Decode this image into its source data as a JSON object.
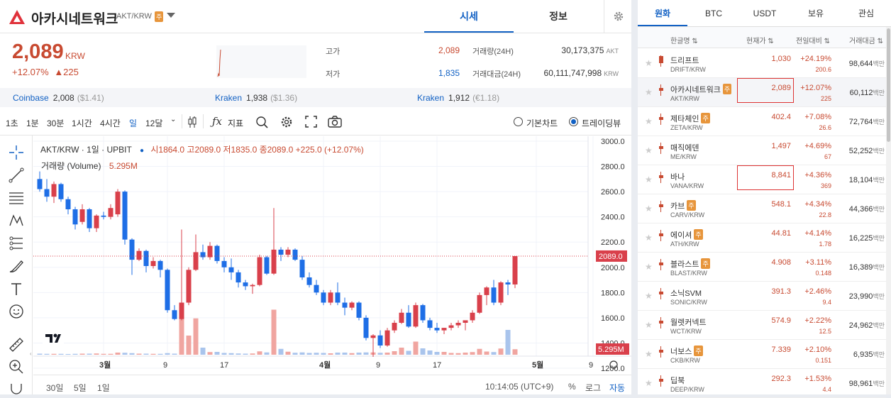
{
  "header": {
    "coin_name": "아카시네트워크",
    "pair": "AKT/KRW",
    "caution": "주",
    "tabs": [
      "시세",
      "정보"
    ]
  },
  "price": {
    "current": "2,089",
    "unit": "KRW",
    "change_pct": "+12.07%",
    "change_abs": "▲225",
    "high_label": "고가",
    "high": "2,089",
    "low_label": "저가",
    "low": "1,835",
    "vol_label": "거래량(24H)",
    "vol": "30,173,375",
    "vol_unit": "AKT",
    "amt_label": "거래대금(24H)",
    "amt": "60,111,747,998",
    "amt_unit": "KRW"
  },
  "exchanges": [
    {
      "name": "Coinbase",
      "price": "2,008",
      "sub": "($1.41)"
    },
    {
      "name": "Kraken",
      "price": "1,938",
      "sub": "($1.36)"
    },
    {
      "name": "Kraken",
      "price": "1,912",
      "sub": "(€1.18)"
    }
  ],
  "toolbar": {
    "intervals": [
      "1초",
      "1분",
      "30분",
      "1시간",
      "4시간",
      "일",
      "12달"
    ],
    "active_interval": "일",
    "indicator_label": "지표",
    "basic_chart": "기본차트",
    "trading_view": "트레이딩뷰"
  },
  "chart_legend": {
    "title": "AKT/KRW · 1일 · UPBIT",
    "ohlc": "시1864.0 고2089.0 저1835.0 종2089.0 +225.0 (+12.07%)",
    "volume_label": "거래량 (Volume)",
    "volume_value": "5.295M"
  },
  "chart_data": {
    "type": "candlestick",
    "y_ticks": [
      "3000.0",
      "2800.0",
      "2600.0",
      "2400.0",
      "2200.0",
      "2000.0",
      "1800.0",
      "1600.0",
      "1400.0",
      "1200.0"
    ],
    "x_ticks": [
      "3월",
      "9",
      "17",
      "4월",
      "9",
      "17",
      "5월",
      "9"
    ],
    "ylim": [
      1200,
      3000
    ],
    "last_price_label": "2089.0",
    "last_volume_label": "5.295M",
    "candles": [
      [
        2700,
        2760,
        2600,
        2620
      ],
      [
        2620,
        2700,
        2520,
        2560
      ],
      [
        2560,
        2680,
        2510,
        2660
      ],
      [
        2660,
        2670,
        2520,
        2540
      ],
      [
        2540,
        2560,
        2420,
        2460
      ],
      [
        2460,
        2480,
        2300,
        2340
      ],
      [
        2360,
        2500,
        2340,
        2460
      ],
      [
        2460,
        2470,
        2280,
        2310
      ],
      [
        2310,
        2420,
        2280,
        2410
      ],
      [
        2410,
        2440,
        2380,
        2400
      ],
      [
        2400,
        2500,
        2380,
        2470
      ],
      [
        2420,
        2620,
        2400,
        2600
      ],
      [
        2600,
        2610,
        2180,
        2220
      ],
      [
        2220,
        2230,
        1940,
        2060
      ],
      [
        2060,
        2150,
        2050,
        2130
      ],
      [
        2130,
        2140,
        1960,
        2010
      ],
      [
        2010,
        2080,
        1990,
        2050
      ],
      [
        2050,
        2060,
        1920,
        1980
      ],
      [
        1980,
        1990,
        1640,
        1660
      ],
      [
        1660,
        1700,
        1580,
        1590
      ],
      [
        1590,
        2300,
        1580,
        1720
      ],
      [
        1720,
        2000,
        1700,
        1980
      ],
      [
        1980,
        2260,
        1970,
        2120
      ],
      [
        2120,
        2180,
        2060,
        2080
      ],
      [
        2080,
        2200,
        2060,
        2170
      ],
      [
        2170,
        2180,
        2030,
        2050
      ],
      [
        2050,
        2080,
        1960,
        2000
      ],
      [
        2000,
        2070,
        1900,
        1960
      ],
      [
        1960,
        1980,
        1840,
        1880
      ],
      [
        1880,
        1900,
        1820,
        1850
      ],
      [
        1850,
        1870,
        1790,
        1860
      ],
      [
        1860,
        2100,
        1850,
        2080
      ],
      [
        2080,
        2090,
        1940,
        1950
      ],
      [
        1950,
        2470,
        1940,
        2140
      ],
      [
        2140,
        2160,
        2050,
        2100
      ],
      [
        2100,
        2160,
        2080,
        2140
      ],
      [
        2140,
        2150,
        2050,
        2060
      ],
      [
        2060,
        2090,
        1900,
        1920
      ],
      [
        1920,
        1960,
        1840,
        1860
      ],
      [
        1860,
        1900,
        1780,
        1800
      ],
      [
        1800,
        1820,
        1700,
        1720
      ],
      [
        1720,
        1820,
        1700,
        1800
      ],
      [
        1800,
        1880,
        1700,
        1720
      ],
      [
        1720,
        1760,
        1620,
        1680
      ],
      [
        1680,
        1730,
        1660,
        1720
      ],
      [
        1720,
        1730,
        1580,
        1600
      ],
      [
        1600,
        1620,
        1420,
        1440
      ],
      [
        1440,
        1470,
        1290,
        1460
      ],
      [
        1460,
        1500,
        1360,
        1380
      ],
      [
        1380,
        1520,
        1370,
        1500
      ],
      [
        1500,
        1580,
        1480,
        1560
      ],
      [
        1560,
        1670,
        1550,
        1640
      ],
      [
        1640,
        1700,
        1520,
        1530
      ],
      [
        1530,
        1720,
        1520,
        1700
      ],
      [
        1700,
        1710,
        1560,
        1580
      ],
      [
        1580,
        1600,
        1500,
        1520
      ],
      [
        1520,
        1560,
        1480,
        1500
      ],
      [
        1500,
        1520,
        1470,
        1520
      ],
      [
        1520,
        1560,
        1500,
        1540
      ],
      [
        1540,
        1580,
        1520,
        1560
      ],
      [
        1560,
        1580,
        1500,
        1580
      ],
      [
        1580,
        1660,
        1560,
        1640
      ],
      [
        1640,
        1800,
        1630,
        1780
      ],
      [
        1780,
        1850,
        1700,
        1840
      ],
      [
        1840,
        1900,
        1700,
        1720
      ],
      [
        1720,
        1890,
        1700,
        1880
      ],
      [
        1880,
        1900,
        1780,
        1864
      ],
      [
        1864,
        2089,
        1835,
        2089
      ]
    ],
    "volume_up": [
      false,
      false,
      true,
      false,
      false,
      false,
      true,
      false,
      true,
      true,
      true,
      true,
      false,
      false,
      true,
      false,
      true,
      false,
      false,
      false,
      true,
      true,
      true,
      false,
      true,
      false,
      false,
      false,
      false,
      false,
      true,
      true,
      false,
      true,
      false,
      true,
      false,
      false,
      false,
      false,
      false,
      true,
      false,
      false,
      true,
      false,
      false,
      true,
      false,
      true,
      true,
      true,
      false,
      true,
      false,
      false,
      false,
      true,
      true,
      true,
      true,
      true,
      true,
      true,
      false,
      true,
      false,
      true
    ],
    "volumes": [
      0.6,
      0.5,
      0.5,
      0.5,
      0.4,
      0.5,
      0.6,
      0.6,
      0.7,
      0.5,
      0.5,
      1.2,
      1.1,
      0.9,
      0.6,
      0.6,
      0.5,
      0.5,
      0.9,
      0.6,
      24.5,
      10.8,
      20.5,
      4.0,
      1.5,
      1.6,
      1.0,
      0.9,
      0.7,
      0.6,
      0.7,
      1.9,
      1.3,
      25.4,
      3.3,
      1.7,
      1.1,
      1.3,
      1.0,
      1.1,
      1.0,
      0.8,
      1.2,
      1.2,
      0.9,
      1.2,
      1.3,
      1.3,
      1.1,
      1.2,
      2.0,
      4.0,
      2.2,
      7.4,
      3.6,
      2.4,
      1.6,
      1.6,
      1.0,
      0.9,
      1.2,
      1.5,
      3.3,
      1.8,
      1.5,
      3.5,
      14.0,
      3.1
    ]
  },
  "bottom_bar": {
    "ranges": [
      "30일",
      "5일",
      "1일"
    ],
    "clock": "10:14:05 (UTC+9)",
    "pct": "%",
    "log": "로그",
    "auto": "자동"
  },
  "market": {
    "tabs": [
      "원화",
      "BTC",
      "USDT",
      "보유",
      "관심"
    ],
    "headers": [
      "한글명",
      "현재가",
      "전일대비",
      "거래대금"
    ],
    "rows": [
      {
        "name": "드리프트",
        "symbol": "DRIFT/KRW",
        "price": "1,030",
        "pct": "+24.19%",
        "abs": "200.6",
        "vol": "98,644",
        "caution": false
      },
      {
        "name": "아카시네트워크",
        "symbol": "AKT/KRW",
        "price": "2,089",
        "pct": "+12.07%",
        "abs": "225",
        "vol": "60,112",
        "caution": true
      },
      {
        "name": "제타체인",
        "symbol": "ZETA/KRW",
        "price": "402.4",
        "pct": "+7.08%",
        "abs": "26.6",
        "vol": "72,764",
        "caution": true
      },
      {
        "name": "매직에덴",
        "symbol": "ME/KRW",
        "price": "1,497",
        "pct": "+4.69%",
        "abs": "67",
        "vol": "52,252",
        "caution": false
      },
      {
        "name": "바나",
        "symbol": "VANA/KRW",
        "price": "8,841",
        "pct": "+4.36%",
        "abs": "369",
        "vol": "18,104",
        "caution": false
      },
      {
        "name": "카브",
        "symbol": "CARV/KRW",
        "price": "548.1",
        "pct": "+4.34%",
        "abs": "22.8",
        "vol": "44,366",
        "caution": true
      },
      {
        "name": "에이셔",
        "symbol": "ATH/KRW",
        "price": "44.81",
        "pct": "+4.14%",
        "abs": "1.78",
        "vol": "16,225",
        "caution": true
      },
      {
        "name": "블라스트",
        "symbol": "BLAST/KRW",
        "price": "4.908",
        "pct": "+3.11%",
        "abs": "0.148",
        "vol": "16,389",
        "caution": true
      },
      {
        "name": "소닉SVM",
        "symbol": "SONIC/KRW",
        "price": "391.3",
        "pct": "+2.46%",
        "abs": "9.4",
        "vol": "23,990",
        "caution": false
      },
      {
        "name": "월렛커넥트",
        "symbol": "WCT/KRW",
        "price": "574.9",
        "pct": "+2.22%",
        "abs": "12.5",
        "vol": "24,962",
        "caution": false
      },
      {
        "name": "너보스",
        "symbol": "CKB/KRW",
        "price": "7.339",
        "pct": "+2.10%",
        "abs": "0.151",
        "vol": "6,935",
        "caution": true
      },
      {
        "name": "딥북",
        "symbol": "DEEP/KRW",
        "price": "292.3",
        "pct": "+1.53%",
        "abs": "4.4",
        "vol": "98,961",
        "caution": false
      }
    ],
    "vol_unit": "백만",
    "caution_label": "주"
  }
}
